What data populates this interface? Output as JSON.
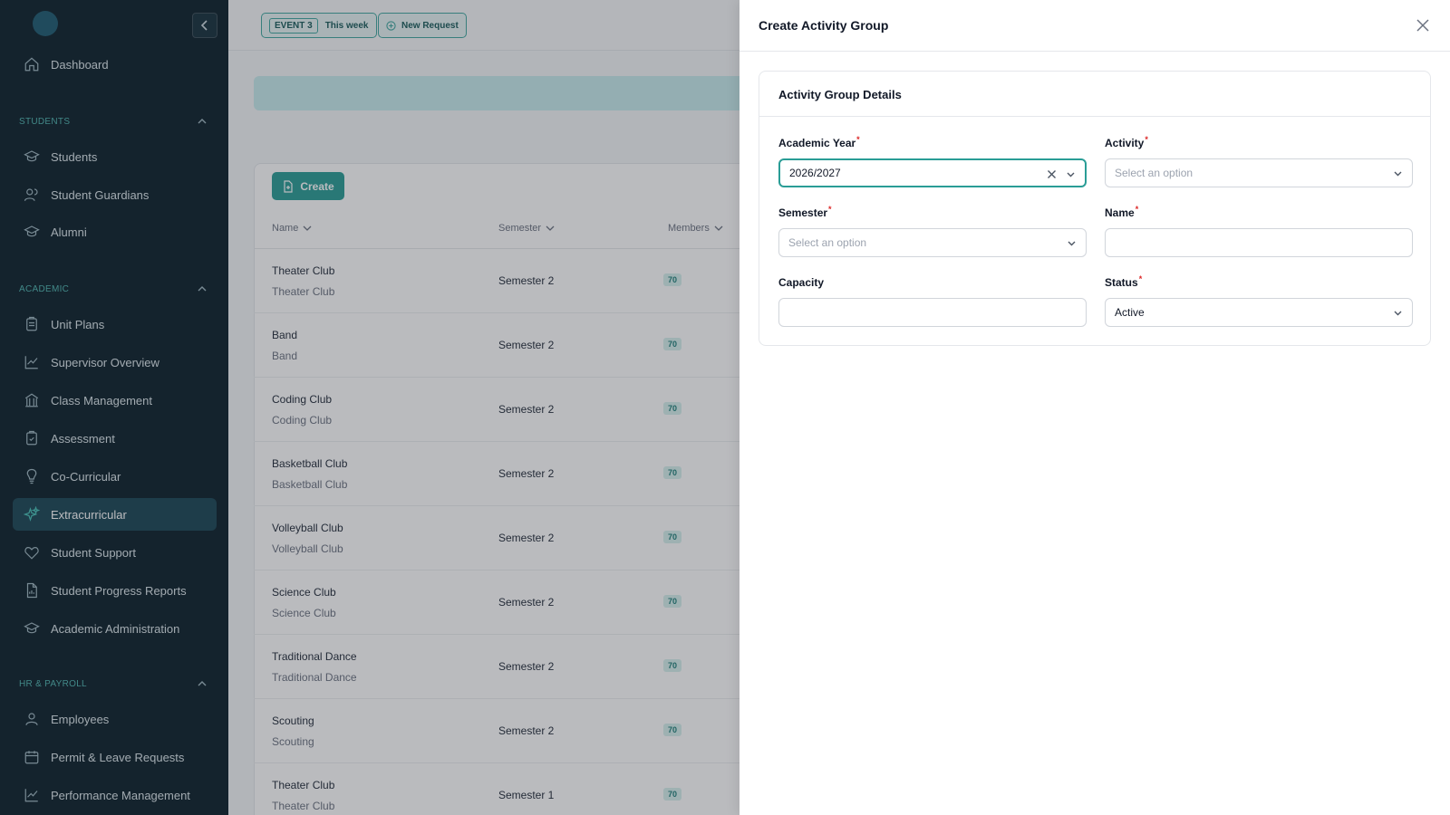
{
  "sidebar": {
    "dashboard": "Dashboard",
    "sections": {
      "students": "STUDENTS",
      "academic": "ACADEMIC",
      "hr": "HR & PAYROLL"
    },
    "items": [
      {
        "label": "Students"
      },
      {
        "label": "Student Guardians"
      },
      {
        "label": "Alumni"
      },
      {
        "label": "Unit Plans"
      },
      {
        "label": "Supervisor Overview"
      },
      {
        "label": "Class Management"
      },
      {
        "label": "Assessment"
      },
      {
        "label": "Co-Curricular"
      },
      {
        "label": "Extracurricular"
      },
      {
        "label": "Student Support"
      },
      {
        "label": "Student Progress Reports"
      },
      {
        "label": "Academic Administration"
      },
      {
        "label": "Employees"
      },
      {
        "label": "Permit & Leave Requests"
      },
      {
        "label": "Performance Management"
      }
    ],
    "active": "Extracurricular"
  },
  "topbar": {
    "event_badge": "EVENT 3",
    "event_range": "This week",
    "new_request": "New Request"
  },
  "table": {
    "create_label": "Create",
    "columns": [
      "Name",
      "Semester",
      "Members"
    ],
    "rows": [
      {
        "name": "Theater Club",
        "subname": "Theater Club",
        "semester": "Semester 2",
        "members": "70"
      },
      {
        "name": "Band",
        "subname": "Band",
        "semester": "Semester 2",
        "members": "70"
      },
      {
        "name": "Coding Club",
        "subname": "Coding Club",
        "semester": "Semester 2",
        "members": "70"
      },
      {
        "name": "Basketball Club",
        "subname": "Basketball Club",
        "semester": "Semester 2",
        "members": "70"
      },
      {
        "name": "Volleyball Club",
        "subname": "Volleyball Club",
        "semester": "Semester 2",
        "members": "70"
      },
      {
        "name": "Science Club",
        "subname": "Science Club",
        "semester": "Semester 2",
        "members": "70"
      },
      {
        "name": "Traditional Dance",
        "subname": "Traditional Dance",
        "semester": "Semester 2",
        "members": "70"
      },
      {
        "name": "Scouting",
        "subname": "Scouting",
        "semester": "Semester 2",
        "members": "70"
      },
      {
        "name": "Theater Club",
        "subname": "Theater Club",
        "semester": "Semester 1",
        "members": "70"
      }
    ]
  },
  "drawer": {
    "title": "Create Activity Group",
    "section_title": "Activity Group Details",
    "fields": {
      "academic_year": {
        "label": "Academic Year",
        "value": "2026/2027",
        "required": "*"
      },
      "activity": {
        "label": "Activity",
        "placeholder": "Select an option",
        "required": "*"
      },
      "semester": {
        "label": "Semester",
        "placeholder": "Select an option",
        "required": "*"
      },
      "name": {
        "label": "Name",
        "value": "",
        "required": "*"
      },
      "capacity": {
        "label": "Capacity",
        "value": ""
      },
      "status": {
        "label": "Status",
        "value": "Active",
        "required": "*"
      }
    }
  },
  "colors": {
    "sidebar_bg": "#0b1f2a",
    "accent": "#2a9d96",
    "required": "#dc2626"
  }
}
